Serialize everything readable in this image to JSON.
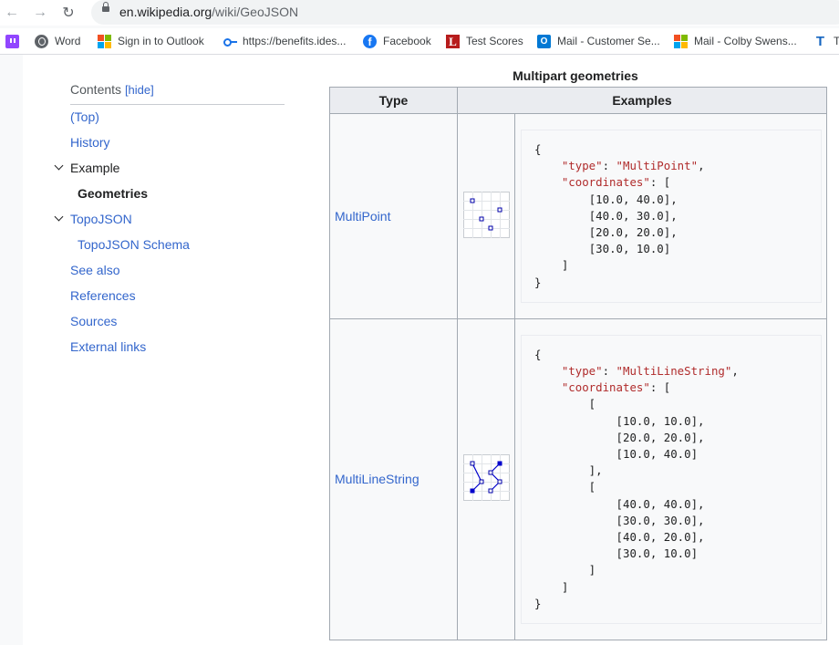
{
  "browser": {
    "url_host": "en.wikipedia.org",
    "url_path": "/wiki/GeoJSON",
    "bookmarks": [
      {
        "label": "",
        "icon": "twitch-icon"
      },
      {
        "label": "Word",
        "icon": "globe-icon"
      },
      {
        "label": "Sign in to Outlook",
        "icon": "microsoft-icon"
      },
      {
        "label": "https://benefits.ides...",
        "icon": "key-icon"
      },
      {
        "label": "Facebook",
        "icon": "facebook-icon"
      },
      {
        "label": "Test Scores",
        "icon": "library-icon"
      },
      {
        "label": "Mail - Customer Se...",
        "icon": "outlook-icon"
      },
      {
        "label": "Mail - Colby Swens...",
        "icon": "microsoft-icon"
      },
      {
        "label": "TC",
        "icon": "t-icon"
      }
    ]
  },
  "toc": {
    "title": "Contents",
    "hide_label": "[hide]",
    "items": [
      {
        "label": "(Top)"
      },
      {
        "label": "History"
      },
      {
        "label": "Example"
      },
      {
        "label": "Geometries"
      },
      {
        "label": "TopoJSON"
      },
      {
        "label": "TopoJSON Schema"
      },
      {
        "label": "See also"
      },
      {
        "label": "References"
      },
      {
        "label": "Sources"
      },
      {
        "label": "External links"
      }
    ]
  },
  "table": {
    "caption": "Multipart geometries",
    "headers": {
      "type": "Type",
      "examples": "Examples"
    },
    "rows": [
      {
        "type": "MultiPoint",
        "json_type": "\"MultiPoint\"",
        "coords": [
          "[10.0, 40.0],",
          "[40.0, 30.0],",
          "[20.0, 20.0],",
          "[30.0, 10.0]"
        ]
      },
      {
        "type": "MultiLineString",
        "json_type": "\"MultiLineString\"",
        "line1": [
          "[10.0, 10.0],",
          "[20.0, 20.0],",
          "[10.0, 40.0]"
        ],
        "line2": [
          "[40.0, 40.0],",
          "[30.0, 30.0],",
          "[40.0, 20.0],",
          "[30.0, 10.0]"
        ]
      }
    ],
    "key_type": "\"type\"",
    "key_coords": "\"coordinates\""
  }
}
